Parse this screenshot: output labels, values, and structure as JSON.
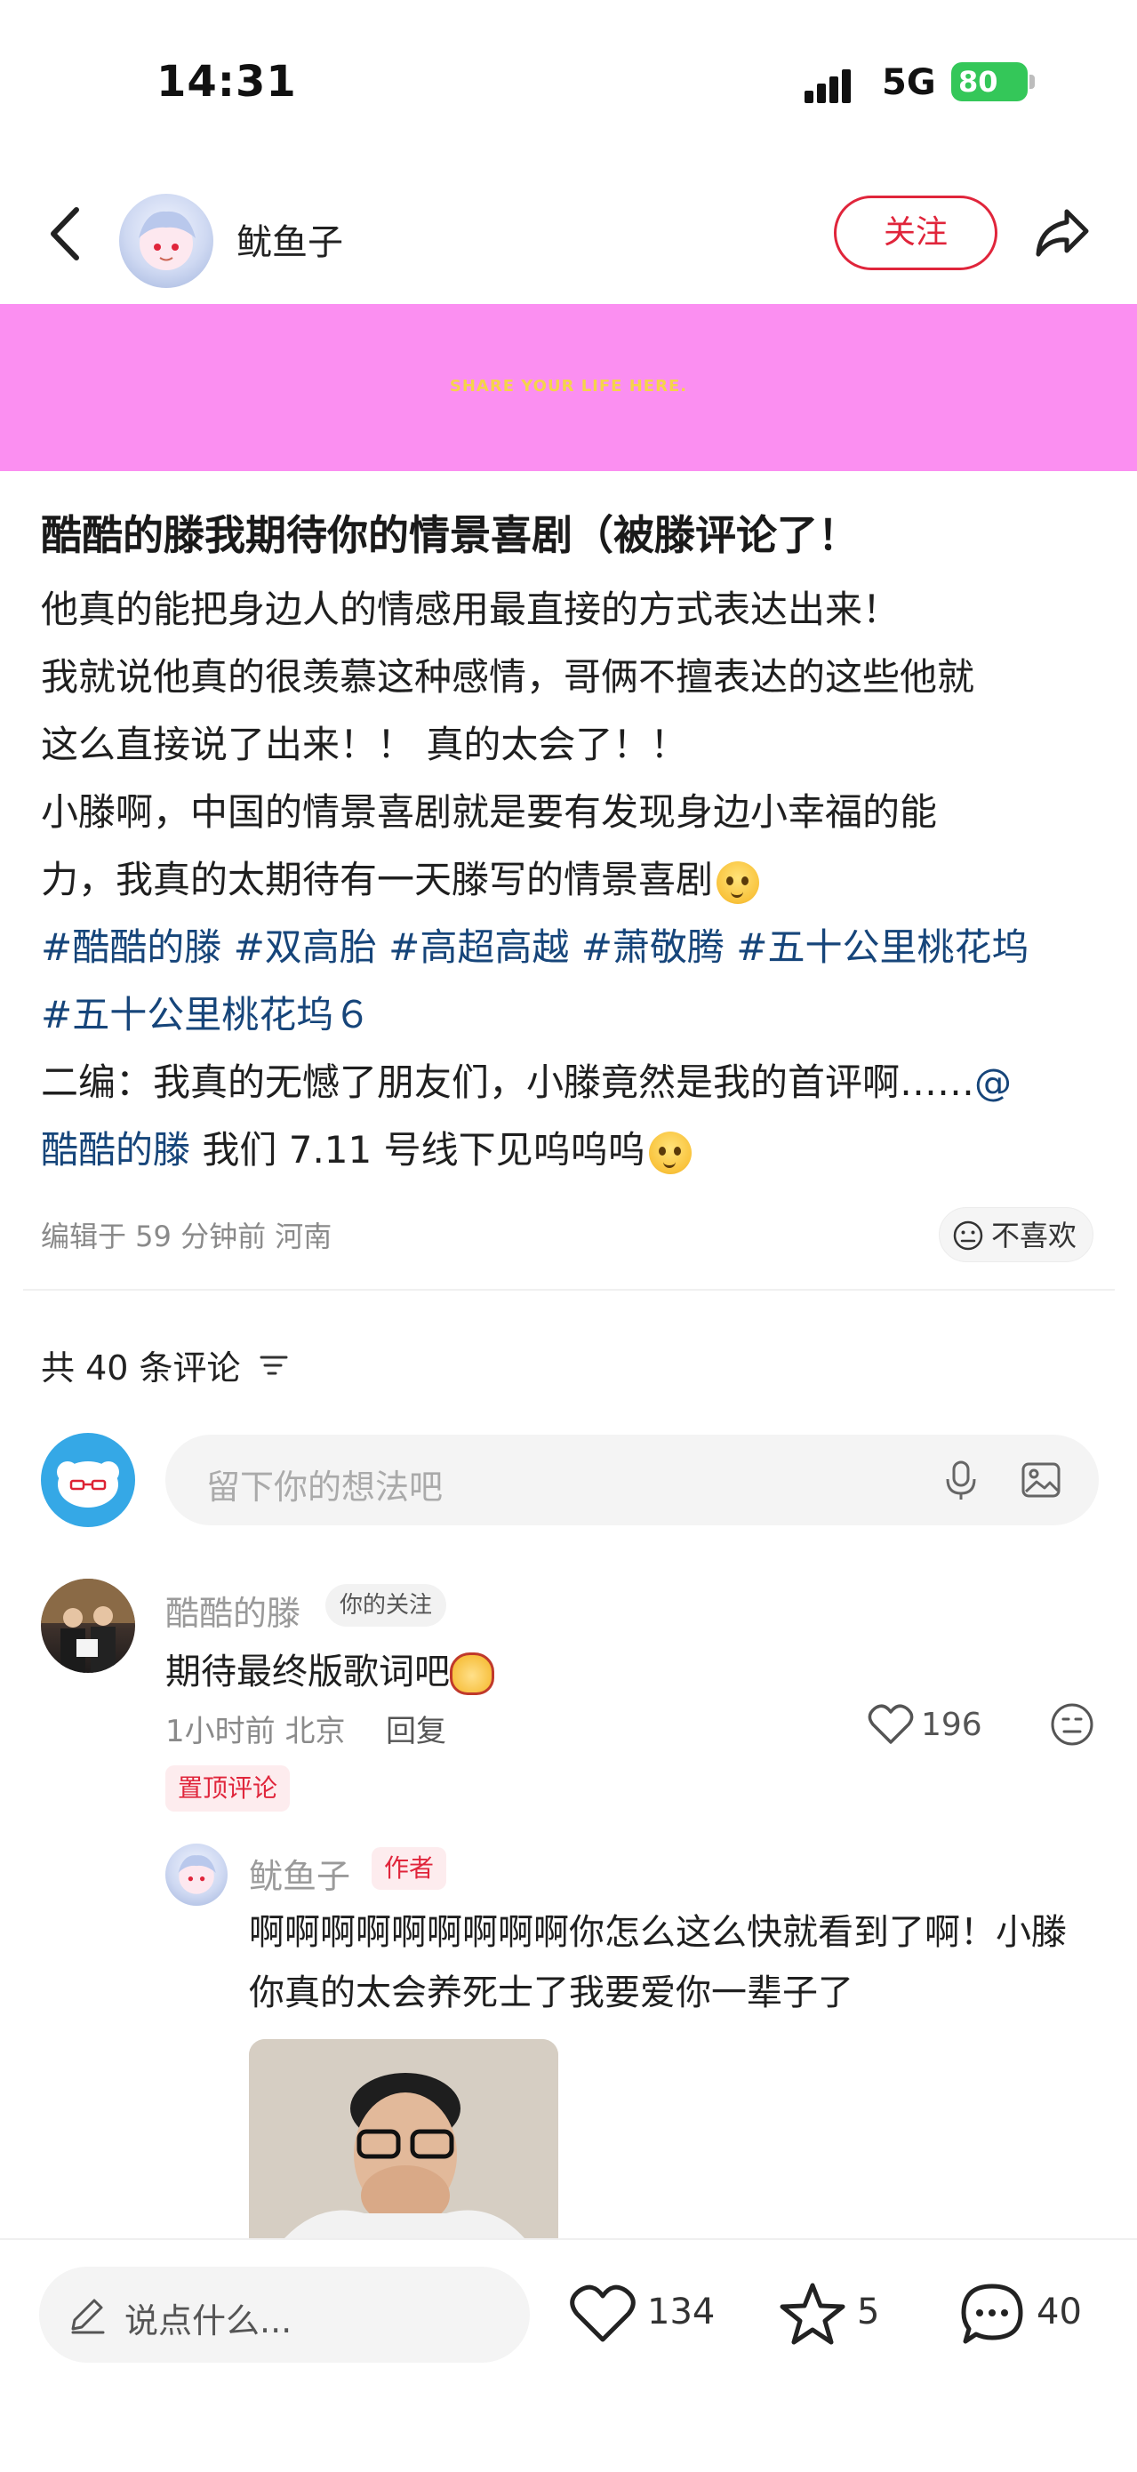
{
  "status_bar": {
    "time": "14:31",
    "network": "5G",
    "battery": "80"
  },
  "header": {
    "author_name": "鱿鱼子",
    "follow_label": "关注"
  },
  "banner": {
    "text": "SHARE YOUR LIFE HERE.",
    "background": "#fb8ff1"
  },
  "post": {
    "title": "酷酷的滕我期待你的情景喜剧（被滕评论了！",
    "lines": [
      "他真的能把身边人的情感用最直接的方式表达出来！",
      "我就说他真的很羡慕这种感情，哥俩不擅表达的这些他就",
      "这么直接说了出来！！ 真的太会了！！",
      "小滕啊，中国的情景喜剧就是要有发现身边小幸福的能",
      "力，我真的太期待有一天滕写的情景喜剧"
    ],
    "tags_line1": [
      "#酷酷的滕",
      "#双高胎",
      "#高超高越",
      "#萧敬腾",
      "#五十公里桃花坞"
    ],
    "tags_line2": [
      "#五十公里桃花坞６"
    ],
    "edit_line1": "二编：我真的无憾了朋友们，小滕竟然是我的首评啊……",
    "edit_mention_at": "@",
    "edit_mention_name": "酷酷的滕",
    "edit_line2_rest": " 我们 7.11 号线下见呜呜呜",
    "meta": "编辑于 59 分钟前 河南",
    "dislike_label": "不喜欢"
  },
  "comments_section": {
    "count_label": "共 40 条评论",
    "input_placeholder": "留下你的想法吧"
  },
  "comments": [
    {
      "name": "酷酷的滕",
      "badge": "你的关注",
      "text": "期待最终版歌词吧",
      "meta": "1小时前 北京",
      "reply_label": "回复",
      "likes": "196",
      "pinned_label": "置顶评论"
    }
  ],
  "reply": {
    "name": "鱿鱼子",
    "badge": "作者",
    "lines": [
      "啊啊啊啊啊啊啊啊啊你怎么这么快就看到了啊！小滕",
      "你真的太会养死士了我要爱你一辈子了"
    ]
  },
  "bottom_bar": {
    "input_placeholder": "说点什么...",
    "likes": "134",
    "stars": "5",
    "comments": "40"
  },
  "colors": {
    "accent": "#e0253b",
    "tag": "#16457a",
    "battery": "#34c759"
  }
}
